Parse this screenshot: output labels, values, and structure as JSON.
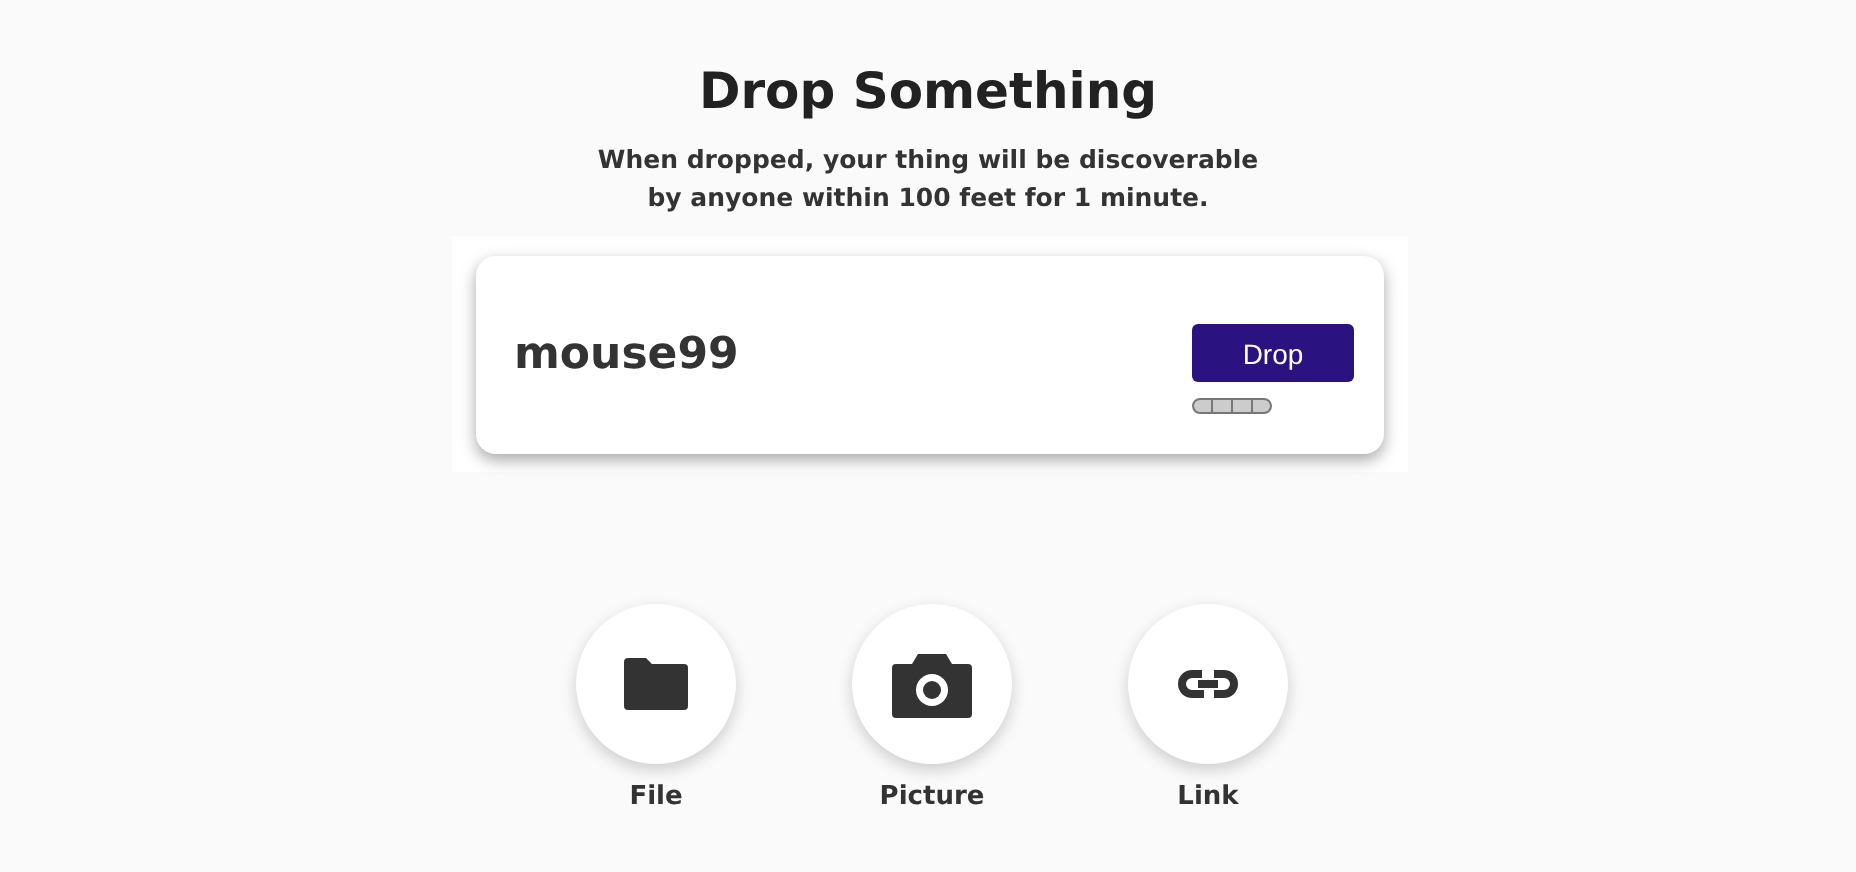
{
  "header": {
    "title": "Drop Something",
    "subtitle": "When dropped, your thing will be discoverable by anyone within 100 feet for 1 minute."
  },
  "card": {
    "name": "mouse99",
    "button": "Drop"
  },
  "options": [
    {
      "kind": "file",
      "label": "File"
    },
    {
      "kind": "picture",
      "label": "Picture"
    },
    {
      "kind": "link",
      "label": "Link"
    }
  ]
}
